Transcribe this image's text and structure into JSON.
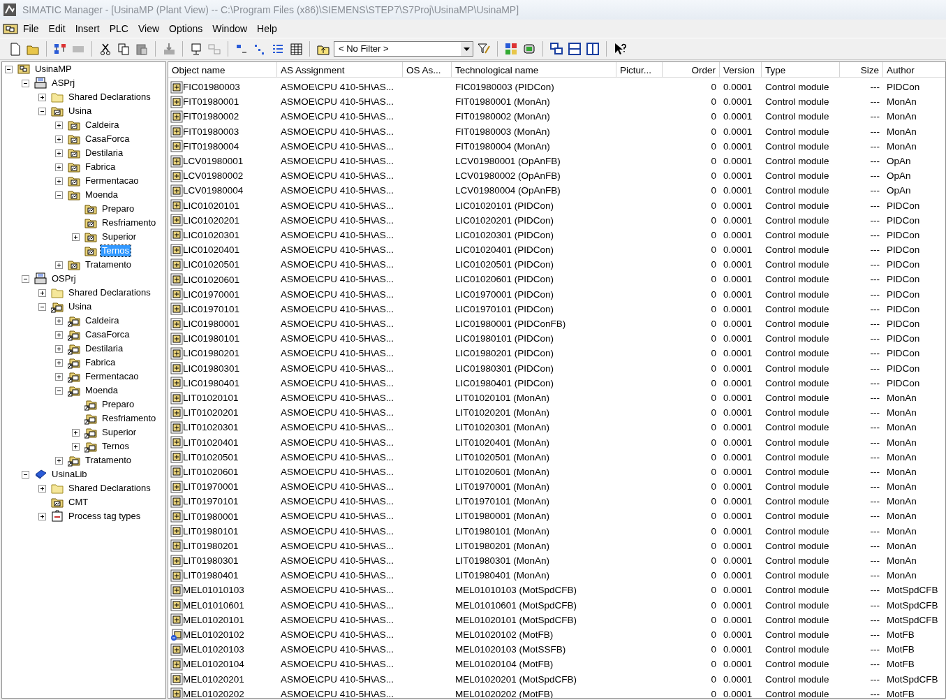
{
  "window": {
    "title": "SIMATIC Manager - [UsinaMP (Plant View) -- C:\\Program Files (x86)\\SIEMENS\\STEP7\\S7Proj\\UsinaMP\\UsinaMP]"
  },
  "menu": [
    "File",
    "Edit",
    "Insert",
    "PLC",
    "View",
    "Options",
    "Window",
    "Help"
  ],
  "toolbar": {
    "filter": "< No Filter >"
  },
  "tree": [
    {
      "label": "UsinaMP",
      "kind": "project",
      "expanded": true,
      "selected": false,
      "children": [
        {
          "label": "ASPrj",
          "kind": "station",
          "expanded": true,
          "selected": false,
          "children": [
            {
              "label": "Shared Declarations",
              "kind": "folder",
              "expanded": false,
              "selected": false
            },
            {
              "label": "Usina",
              "kind": "hierarchy",
              "expanded": true,
              "selected": false,
              "children": [
                {
                  "label": "Caldeira",
                  "kind": "hierarchy",
                  "expanded": false,
                  "selected": false
                },
                {
                  "label": "CasaForca",
                  "kind": "hierarchy",
                  "expanded": false,
                  "selected": false
                },
                {
                  "label": "Destilaria",
                  "kind": "hierarchy",
                  "expanded": false,
                  "selected": false
                },
                {
                  "label": "Fabrica",
                  "kind": "hierarchy",
                  "expanded": false,
                  "selected": false
                },
                {
                  "label": "Fermentacao",
                  "kind": "hierarchy",
                  "expanded": false,
                  "selected": false
                },
                {
                  "label": "Moenda",
                  "kind": "hierarchy",
                  "expanded": true,
                  "selected": false,
                  "children": [
                    {
                      "label": "Preparo",
                      "kind": "hierarchy",
                      "selected": false
                    },
                    {
                      "label": "Resfriamento",
                      "kind": "hierarchy",
                      "selected": false
                    },
                    {
                      "label": "Superior",
                      "kind": "hierarchy",
                      "expanded": false,
                      "selected": false
                    },
                    {
                      "label": "Ternos",
                      "kind": "hierarchy",
                      "selected": true
                    }
                  ]
                },
                {
                  "label": "Tratamento",
                  "kind": "hierarchy",
                  "expanded": false,
                  "selected": false
                }
              ]
            }
          ]
        },
        {
          "label": "OSPrj",
          "kind": "station",
          "expanded": true,
          "selected": false,
          "children": [
            {
              "label": "Shared Declarations",
              "kind": "folder",
              "expanded": false,
              "selected": false
            },
            {
              "label": "Usina",
              "kind": "linked",
              "expanded": true,
              "selected": false,
              "children": [
                {
                  "label": "Caldeira",
                  "kind": "linked",
                  "expanded": false,
                  "selected": false
                },
                {
                  "label": "CasaForca",
                  "kind": "linked",
                  "expanded": false,
                  "selected": false
                },
                {
                  "label": "Destilaria",
                  "kind": "linked",
                  "expanded": false,
                  "selected": false
                },
                {
                  "label": "Fabrica",
                  "kind": "linked",
                  "expanded": false,
                  "selected": false
                },
                {
                  "label": "Fermentacao",
                  "kind": "linked",
                  "expanded": false,
                  "selected": false
                },
                {
                  "label": "Moenda",
                  "kind": "linked",
                  "expanded": true,
                  "selected": false,
                  "children": [
                    {
                      "label": "Preparo",
                      "kind": "linked",
                      "selected": false
                    },
                    {
                      "label": "Resfriamento",
                      "kind": "linked",
                      "selected": false
                    },
                    {
                      "label": "Superior",
                      "kind": "linked",
                      "expanded": false,
                      "selected": false
                    },
                    {
                      "label": "Ternos",
                      "kind": "linked",
                      "expanded": false,
                      "selected": false
                    }
                  ]
                },
                {
                  "label": "Tratamento",
                  "kind": "linked",
                  "expanded": false,
                  "selected": false
                }
              ]
            }
          ]
        },
        {
          "label": "UsinaLib",
          "kind": "library",
          "expanded": true,
          "selected": false,
          "children": [
            {
              "label": "Shared Declarations",
              "kind": "folder",
              "expanded": false,
              "selected": false
            },
            {
              "label": "CMT",
              "kind": "hierarchy",
              "selected": false
            },
            {
              "label": "Process tag types",
              "kind": "tagtypes",
              "expanded": false,
              "selected": false
            }
          ]
        }
      ]
    }
  ],
  "table": {
    "columns": [
      "Object name",
      "AS Assignment",
      "OS As...",
      "Technological name",
      "Pictur...",
      "Order",
      "Version",
      "Type",
      "Size",
      "Author"
    ],
    "rows": [
      {
        "kind": "module",
        "name": "FIC01980003",
        "as": "ASMOE\\CPU 410-5H\\AS...",
        "tech": "FIC01980003 (PIDCon)",
        "order": "0",
        "version": "0.0001",
        "type": "Control module",
        "size": "---",
        "author": "PIDCon"
      },
      {
        "kind": "module",
        "name": "FIT01980001",
        "as": "ASMOE\\CPU 410-5H\\AS...",
        "tech": "FIT01980001 (MonAn)",
        "order": "0",
        "version": "0.0001",
        "type": "Control module",
        "size": "---",
        "author": "MonAn"
      },
      {
        "kind": "module",
        "name": "FIT01980002",
        "as": "ASMOE\\CPU 410-5H\\AS...",
        "tech": "FIT01980002 (MonAn)",
        "order": "0",
        "version": "0.0001",
        "type": "Control module",
        "size": "---",
        "author": "MonAn"
      },
      {
        "kind": "module",
        "name": "FIT01980003",
        "as": "ASMOE\\CPU 410-5H\\AS...",
        "tech": "FIT01980003 (MonAn)",
        "order": "0",
        "version": "0.0001",
        "type": "Control module",
        "size": "---",
        "author": "MonAn"
      },
      {
        "kind": "module",
        "name": "FIT01980004",
        "as": "ASMOE\\CPU 410-5H\\AS...",
        "tech": "FIT01980004 (MonAn)",
        "order": "0",
        "version": "0.0001",
        "type": "Control module",
        "size": "---",
        "author": "MonAn"
      },
      {
        "kind": "module",
        "name": "LCV01980001",
        "as": "ASMOE\\CPU 410-5H\\AS...",
        "tech": "LCV01980001 (OpAnFB)",
        "order": "0",
        "version": "0.0001",
        "type": "Control module",
        "size": "---",
        "author": "OpAn"
      },
      {
        "kind": "module",
        "name": "LCV01980002",
        "as": "ASMOE\\CPU 410-5H\\AS...",
        "tech": "LCV01980002 (OpAnFB)",
        "order": "0",
        "version": "0.0001",
        "type": "Control module",
        "size": "---",
        "author": "OpAn"
      },
      {
        "kind": "module",
        "name": "LCV01980004",
        "as": "ASMOE\\CPU 410-5H\\AS...",
        "tech": "LCV01980004 (OpAnFB)",
        "order": "0",
        "version": "0.0001",
        "type": "Control module",
        "size": "---",
        "author": "OpAn"
      },
      {
        "kind": "module",
        "name": "LIC01020101",
        "as": "ASMOE\\CPU 410-5H\\AS...",
        "tech": "LIC01020101 (PIDCon)",
        "order": "0",
        "version": "0.0001",
        "type": "Control module",
        "size": "---",
        "author": "PIDCon"
      },
      {
        "kind": "module",
        "name": "LIC01020201",
        "as": "ASMOE\\CPU 410-5H\\AS...",
        "tech": "LIC01020201 (PIDCon)",
        "order": "0",
        "version": "0.0001",
        "type": "Control module",
        "size": "---",
        "author": "PIDCon"
      },
      {
        "kind": "module",
        "name": "LIC01020301",
        "as": "ASMOE\\CPU 410-5H\\AS...",
        "tech": "LIC01020301 (PIDCon)",
        "order": "0",
        "version": "0.0001",
        "type": "Control module",
        "size": "---",
        "author": "PIDCon"
      },
      {
        "kind": "module",
        "name": "LIC01020401",
        "as": "ASMOE\\CPU 410-5H\\AS...",
        "tech": "LIC01020401 (PIDCon)",
        "order": "0",
        "version": "0.0001",
        "type": "Control module",
        "size": "---",
        "author": "PIDCon"
      },
      {
        "kind": "module",
        "name": "LIC01020501",
        "as": "ASMOE\\CPU 410-5H\\AS...",
        "tech": "LIC01020501 (PIDCon)",
        "order": "0",
        "version": "0.0001",
        "type": "Control module",
        "size": "---",
        "author": "PIDCon"
      },
      {
        "kind": "module",
        "name": "LIC01020601",
        "as": "ASMOE\\CPU 410-5H\\AS...",
        "tech": "LIC01020601 (PIDCon)",
        "order": "0",
        "version": "0.0001",
        "type": "Control module",
        "size": "---",
        "author": "PIDCon"
      },
      {
        "kind": "module",
        "name": "LIC01970001",
        "as": "ASMOE\\CPU 410-5H\\AS...",
        "tech": "LIC01970001 (PIDCon)",
        "order": "0",
        "version": "0.0001",
        "type": "Control module",
        "size": "---",
        "author": "PIDCon"
      },
      {
        "kind": "module",
        "name": "LIC01970101",
        "as": "ASMOE\\CPU 410-5H\\AS...",
        "tech": "LIC01970101 (PIDCon)",
        "order": "0",
        "version": "0.0001",
        "type": "Control module",
        "size": "---",
        "author": "PIDCon"
      },
      {
        "kind": "module",
        "name": "LIC01980001",
        "as": "ASMOE\\CPU 410-5H\\AS...",
        "tech": "LIC01980001 (PIDConFB)",
        "order": "0",
        "version": "0.0001",
        "type": "Control module",
        "size": "---",
        "author": "PIDCon"
      },
      {
        "kind": "module",
        "name": "LIC01980101",
        "as": "ASMOE\\CPU 410-5H\\AS...",
        "tech": "LIC01980101 (PIDCon)",
        "order": "0",
        "version": "0.0001",
        "type": "Control module",
        "size": "---",
        "author": "PIDCon"
      },
      {
        "kind": "module",
        "name": "LIC01980201",
        "as": "ASMOE\\CPU 410-5H\\AS...",
        "tech": "LIC01980201 (PIDCon)",
        "order": "0",
        "version": "0.0001",
        "type": "Control module",
        "size": "---",
        "author": "PIDCon"
      },
      {
        "kind": "module",
        "name": "LIC01980301",
        "as": "ASMOE\\CPU 410-5H\\AS...",
        "tech": "LIC01980301 (PIDCon)",
        "order": "0",
        "version": "0.0001",
        "type": "Control module",
        "size": "---",
        "author": "PIDCon"
      },
      {
        "kind": "module",
        "name": "LIC01980401",
        "as": "ASMOE\\CPU 410-5H\\AS...",
        "tech": "LIC01980401 (PIDCon)",
        "order": "0",
        "version": "0.0001",
        "type": "Control module",
        "size": "---",
        "author": "PIDCon"
      },
      {
        "kind": "module",
        "name": "LIT01020101",
        "as": "ASMOE\\CPU 410-5H\\AS...",
        "tech": "LIT01020101 (MonAn)",
        "order": "0",
        "version": "0.0001",
        "type": "Control module",
        "size": "---",
        "author": "MonAn"
      },
      {
        "kind": "module",
        "name": "LIT01020201",
        "as": "ASMOE\\CPU 410-5H\\AS...",
        "tech": "LIT01020201 (MonAn)",
        "order": "0",
        "version": "0.0001",
        "type": "Control module",
        "size": "---",
        "author": "MonAn"
      },
      {
        "kind": "module",
        "name": "LIT01020301",
        "as": "ASMOE\\CPU 410-5H\\AS...",
        "tech": "LIT01020301 (MonAn)",
        "order": "0",
        "version": "0.0001",
        "type": "Control module",
        "size": "---",
        "author": "MonAn"
      },
      {
        "kind": "module",
        "name": "LIT01020401",
        "as": "ASMOE\\CPU 410-5H\\AS...",
        "tech": "LIT01020401 (MonAn)",
        "order": "0",
        "version": "0.0001",
        "type": "Control module",
        "size": "---",
        "author": "MonAn"
      },
      {
        "kind": "module",
        "name": "LIT01020501",
        "as": "ASMOE\\CPU 410-5H\\AS...",
        "tech": "LIT01020501 (MonAn)",
        "order": "0",
        "version": "0.0001",
        "type": "Control module",
        "size": "---",
        "author": "MonAn"
      },
      {
        "kind": "module",
        "name": "LIT01020601",
        "as": "ASMOE\\CPU 410-5H\\AS...",
        "tech": "LIT01020601 (MonAn)",
        "order": "0",
        "version": "0.0001",
        "type": "Control module",
        "size": "---",
        "author": "MonAn"
      },
      {
        "kind": "module",
        "name": "LIT01970001",
        "as": "ASMOE\\CPU 410-5H\\AS...",
        "tech": "LIT01970001 (MonAn)",
        "order": "0",
        "version": "0.0001",
        "type": "Control module",
        "size": "---",
        "author": "MonAn"
      },
      {
        "kind": "module",
        "name": "LIT01970101",
        "as": "ASMOE\\CPU 410-5H\\AS...",
        "tech": "LIT01970101 (MonAn)",
        "order": "0",
        "version": "0.0001",
        "type": "Control module",
        "size": "---",
        "author": "MonAn"
      },
      {
        "kind": "module",
        "name": "LIT01980001",
        "as": "ASMOE\\CPU 410-5H\\AS...",
        "tech": "LIT01980001 (MonAn)",
        "order": "0",
        "version": "0.0001",
        "type": "Control module",
        "size": "---",
        "author": "MonAn"
      },
      {
        "kind": "module",
        "name": "LIT01980101",
        "as": "ASMOE\\CPU 410-5H\\AS...",
        "tech": "LIT01980101 (MonAn)",
        "order": "0",
        "version": "0.0001",
        "type": "Control module",
        "size": "---",
        "author": "MonAn"
      },
      {
        "kind": "module",
        "name": "LIT01980201",
        "as": "ASMOE\\CPU 410-5H\\AS...",
        "tech": "LIT01980201 (MonAn)",
        "order": "0",
        "version": "0.0001",
        "type": "Control module",
        "size": "---",
        "author": "MonAn"
      },
      {
        "kind": "module",
        "name": "LIT01980301",
        "as": "ASMOE\\CPU 410-5H\\AS...",
        "tech": "LIT01980301 (MonAn)",
        "order": "0",
        "version": "0.0001",
        "type": "Control module",
        "size": "---",
        "author": "MonAn"
      },
      {
        "kind": "module",
        "name": "LIT01980401",
        "as": "ASMOE\\CPU 410-5H\\AS...",
        "tech": "LIT01980401 (MonAn)",
        "order": "0",
        "version": "0.0001",
        "type": "Control module",
        "size": "---",
        "author": "MonAn"
      },
      {
        "kind": "module",
        "name": "MEL01010103",
        "as": "ASMOE\\CPU 410-5H\\AS...",
        "tech": "MEL01010103 (MotSpdCFB)",
        "order": "0",
        "version": "0.0001",
        "type": "Control module",
        "size": "---",
        "author": "MotSpdCFB"
      },
      {
        "kind": "module",
        "name": "MEL01010601",
        "as": "ASMOE\\CPU 410-5H\\AS...",
        "tech": "MEL01010601 (MotSpdCFB)",
        "order": "0",
        "version": "0.0001",
        "type": "Control module",
        "size": "---",
        "author": "MotSpdCFB"
      },
      {
        "kind": "module",
        "name": "MEL01020101",
        "as": "ASMOE\\CPU 410-5H\\AS...",
        "tech": "MEL01020101 (MotSpdCFB)",
        "order": "0",
        "version": "0.0001",
        "type": "Control module",
        "size": "---",
        "author": "MotSpdCFB"
      },
      {
        "kind": "linked",
        "name": "MEL01020102",
        "as": "ASMOE\\CPU 410-5H\\AS...",
        "tech": "MEL01020102 (MotFB)",
        "order": "0",
        "version": "0.0001",
        "type": "Control module",
        "size": "---",
        "author": "MotFB"
      },
      {
        "kind": "module",
        "name": "MEL01020103",
        "as": "ASMOE\\CPU 410-5H\\AS...",
        "tech": "MEL01020103 (MotSSFB)",
        "order": "0",
        "version": "0.0001",
        "type": "Control module",
        "size": "---",
        "author": "MotFB"
      },
      {
        "kind": "module",
        "name": "MEL01020104",
        "as": "ASMOE\\CPU 410-5H\\AS...",
        "tech": "MEL01020104 (MotFB)",
        "order": "0",
        "version": "0.0001",
        "type": "Control module",
        "size": "---",
        "author": "MotFB"
      },
      {
        "kind": "module",
        "name": "MEL01020201",
        "as": "ASMOE\\CPU 410-5H\\AS...",
        "tech": "MEL01020201 (MotSpdCFB)",
        "order": "0",
        "version": "0.0001",
        "type": "Control module",
        "size": "---",
        "author": "MotSpdCFB"
      },
      {
        "kind": "module",
        "name": "MEL01020202",
        "as": "ASMOE\\CPU 410-5H\\AS...",
        "tech": "MEL01020202 (MotFB)",
        "order": "0",
        "version": "0.0001",
        "type": "Control module",
        "size": "---",
        "author": "MotFB"
      }
    ]
  }
}
